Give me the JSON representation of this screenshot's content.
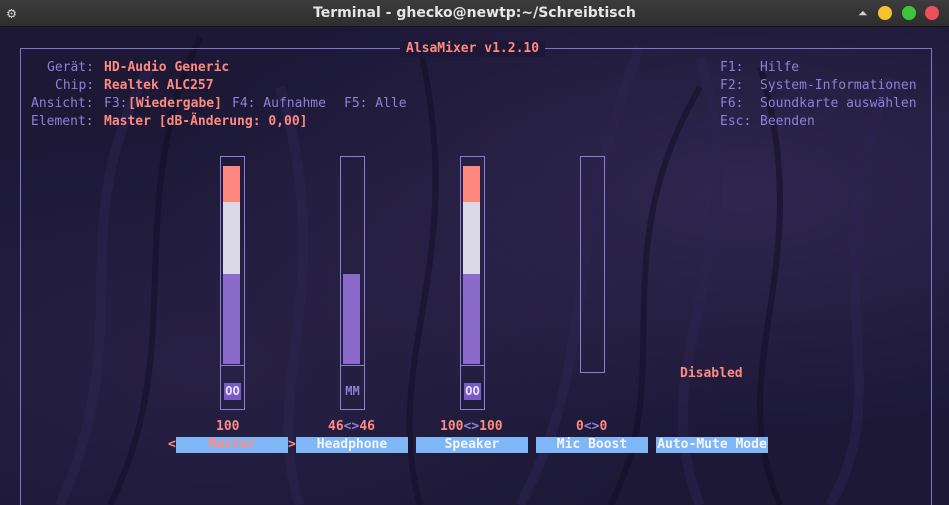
{
  "window": {
    "title": "Terminal - ghecko@newtp:~/Schreibtisch"
  },
  "mixer": {
    "title": "AlsaMixer v1.2.10",
    "info": {
      "geraet_label": "Gerät:",
      "geraet_value": "HD-Audio Generic",
      "chip_label": "Chip:",
      "chip_value": "Realtek ALC257",
      "ansicht_label": "Ansicht:",
      "ansicht_f3": "F3:",
      "ansicht_f3_value": "[Wiedergabe]",
      "ansicht_f4": "F4: Aufnahme",
      "ansicht_f5": "F5: Alle",
      "element_label": "Element:",
      "element_value": "Master [dB-Änderung: 0,00]"
    },
    "help": [
      {
        "key": "F1:",
        "text": "Hilfe"
      },
      {
        "key": "F2:",
        "text": "System-Informationen"
      },
      {
        "key": "F6:",
        "text": "Soundkarte auswählen"
      },
      {
        "key": "Esc:",
        "text": "Beenden"
      }
    ],
    "channels": [
      {
        "name": "Master",
        "volume": "100",
        "mute": "OO",
        "level": 1.0,
        "selected": true
      },
      {
        "name": "Headphone",
        "volume_left": "46",
        "volume_right": "46",
        "arrows": "<>",
        "mute": "MM",
        "level": 0.46,
        "selected": false
      },
      {
        "name": "Speaker",
        "volume_left": "100",
        "volume_right": "100",
        "arrows": "<>",
        "mute": "OO",
        "level": 1.0,
        "selected": false
      },
      {
        "name": "Mic Boost",
        "volume_left": "0",
        "volume_right": "0",
        "arrows": "<>",
        "level": 0.0,
        "selected": false
      },
      {
        "name": "Auto-Mute Mode",
        "status": "Disabled",
        "selected": false
      }
    ],
    "selector": {
      "left": "<",
      "right": ">"
    },
    "colors": {
      "accent_red": "#ff8a80",
      "label_purple": "#8d80d8",
      "channel_bar": "#7fb6f5",
      "meter_fill": "#8a6bcc",
      "meter_white": "#dcd9e6"
    }
  }
}
